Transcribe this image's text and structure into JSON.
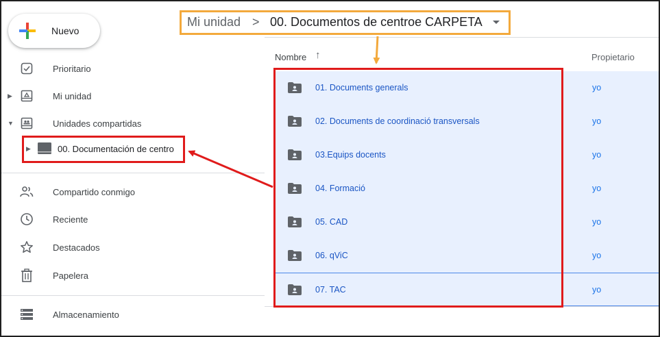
{
  "new_button": {
    "label": "Nuevo"
  },
  "sidebar": {
    "items": [
      {
        "label": "Prioritario",
        "icon": "priority-check-icon"
      },
      {
        "label": "Mi unidad",
        "icon": "my-drive-icon"
      },
      {
        "label": "Unidades compartidas",
        "icon": "shared-drives-icon"
      },
      {
        "label": "00. Documentación de centro",
        "icon": "shared-drive-icon"
      },
      {
        "label": "Compartido conmigo",
        "icon": "people-icon"
      },
      {
        "label": "Reciente",
        "icon": "clock-icon"
      },
      {
        "label": "Destacados",
        "icon": "star-icon"
      },
      {
        "label": "Papelera",
        "icon": "trash-icon"
      },
      {
        "label": "Almacenamiento",
        "icon": "storage-icon"
      }
    ]
  },
  "breadcrumb": {
    "root": "Mi unidad",
    "separator": ">",
    "current": "00. Documentos de centroe CARPETA"
  },
  "columns": {
    "name": "Nombre",
    "sort_arrow": "↑",
    "owner": "Propietario"
  },
  "files": [
    {
      "name": "01. Documents generals",
      "owner": "yo"
    },
    {
      "name": "02. Documents de coordinació transversals",
      "owner": "yo"
    },
    {
      "name": "03.Equips docents",
      "owner": "yo"
    },
    {
      "name": "04. Formació",
      "owner": "yo"
    },
    {
      "name": "05. CAD",
      "owner": "yo"
    },
    {
      "name": "06. qViC",
      "owner": "yo"
    },
    {
      "name": "07. TAC",
      "owner": "yo"
    }
  ],
  "colors": {
    "annotation_red": "#e01b1b",
    "annotation_orange": "#f3a93c",
    "selection_bg": "#e8f0fe",
    "link_blue": "#1a55c4"
  }
}
